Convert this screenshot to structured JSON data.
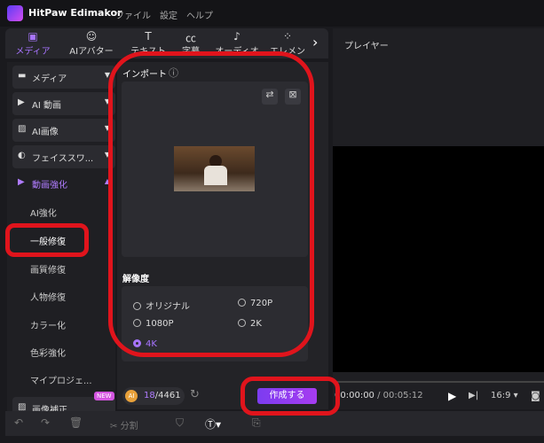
{
  "app": {
    "name": "HitPaw Edimakor",
    "menu": [
      "ファイル",
      "設定",
      "ヘルプ"
    ]
  },
  "tabs": [
    {
      "label": "メディア",
      "icon": "media-icon",
      "active": true
    },
    {
      "label": "AIアバター",
      "icon": "avatar-icon"
    },
    {
      "label": "テキスト",
      "icon": "text-icon"
    },
    {
      "label": "字幕",
      "icon": "subtitle-icon"
    },
    {
      "label": "オーディオ",
      "icon": "audio-icon"
    },
    {
      "label": "エレメン",
      "icon": "elements-icon"
    }
  ],
  "sidebar": {
    "items": [
      {
        "label": "メディア",
        "icon": "folder-icon"
      },
      {
        "label": "AI 動画",
        "icon": "ai-video-icon"
      },
      {
        "label": "AI画像",
        "icon": "ai-image-icon"
      },
      {
        "label": "フェイススワ...",
        "icon": "face-swap-icon"
      },
      {
        "label": "動画強化",
        "icon": "video-enhance-icon",
        "active": true
      }
    ],
    "subitems": [
      "AI強化",
      "一般修復",
      "画質修復",
      "人物修復",
      "カラー化",
      "色彩強化",
      "マイプロジェ..."
    ],
    "active_sub": "一般修復",
    "last": {
      "label": "画像補正",
      "badge": "NEW"
    }
  },
  "import": {
    "label": "インポート",
    "info": "ⓘ"
  },
  "resolution": {
    "label": "解像度",
    "options": [
      "オリジナル",
      "720P",
      "1080P",
      "2K",
      "4K"
    ],
    "selected": "4K"
  },
  "credits": {
    "used": "18",
    "total": "/4461",
    "badge": "AI"
  },
  "create_button": "作成する",
  "player": {
    "title": "プレイヤー",
    "current": "00:00:00",
    "duration": " / 00:05:12",
    "ratio": "16:9"
  },
  "toolbar": {
    "split": "分割"
  },
  "colors": {
    "accent": "#a774ff",
    "annotation": "#e0141c"
  }
}
